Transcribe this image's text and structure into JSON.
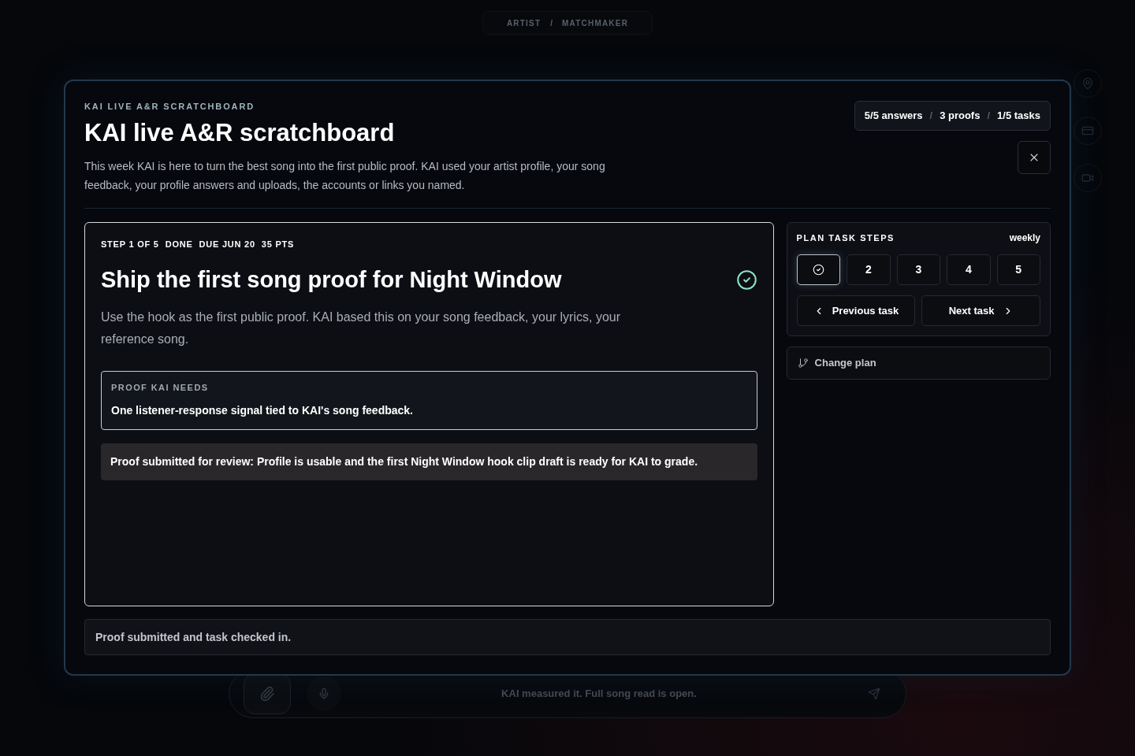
{
  "background": {
    "breadcrumb": [
      {
        "label": "ARTIST",
        "separator_after": "/"
      },
      {
        "label": "MATCHMAKER"
      }
    ],
    "composer": {
      "text": "KAI measured it. Full song read is open."
    }
  },
  "modal": {
    "eyebrow": "KAI LIVE A&R SCRATCHBOARD",
    "title": "KAI live A&R scratchboard",
    "description": "This week KAI is here to turn the best song into the first public proof. KAI used your artist profile, your song feedback, your profile answers and uploads, the accounts or links you named.",
    "stats": [
      {
        "label": "5/5 answers",
        "separator_after": "/"
      },
      {
        "label": "3 proofs",
        "separator_after": "/"
      },
      {
        "label": "1/5 tasks"
      }
    ],
    "task": {
      "meta": [
        "STEP 1 OF 5",
        "DONE",
        "DUE JUN 20",
        "35 PTS"
      ],
      "title": "Ship the first song proof for Night Window",
      "done": true,
      "description": "Use the hook as the first public proof. KAI based this on your song feedback, your lyrics, your reference song.",
      "proof_needed": {
        "label": "PROOF KAI NEEDS",
        "text": "One listener-response signal tied to KAI's song feedback."
      },
      "submission": "Proof submitted for review: Profile is usable and the first Night Window hook clip draft is ready for KAI to grade."
    },
    "plan": {
      "title": "PLAN TASK STEPS",
      "cadence": "weekly",
      "steps": [
        {
          "done": true,
          "selected": true
        },
        {
          "label": "2",
          "done": false,
          "selected": false
        },
        {
          "label": "3",
          "done": false,
          "selected": false
        },
        {
          "label": "4",
          "done": false,
          "selected": false
        },
        {
          "label": "5",
          "done": false,
          "selected": false
        }
      ],
      "previous": "Previous task",
      "next": "Next task"
    },
    "change_plan": "Change plan",
    "status": "Proof submitted and task checked in."
  }
}
